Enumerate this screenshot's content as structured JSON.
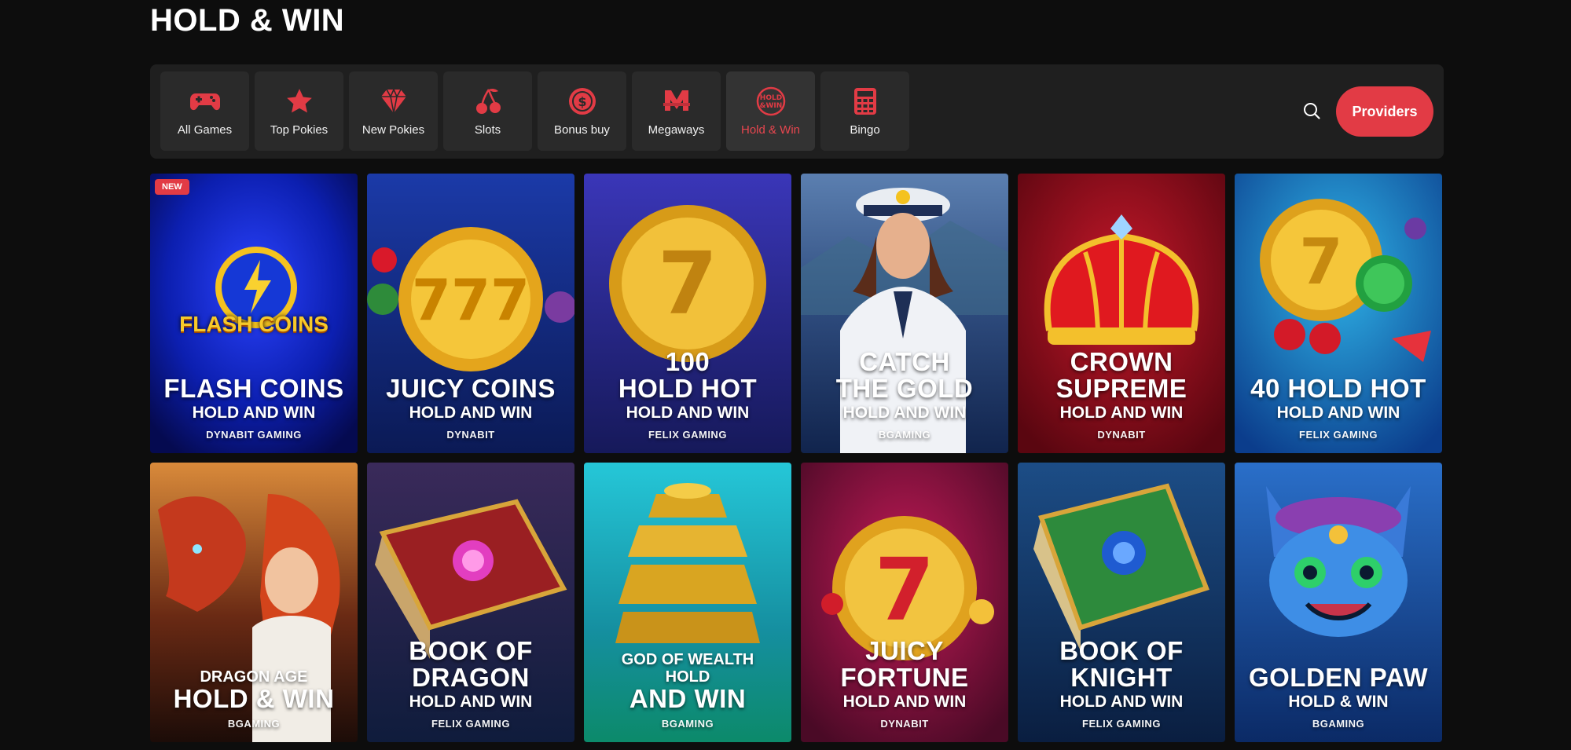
{
  "page": {
    "title": "HOLD & WIN"
  },
  "categories": [
    {
      "label": "All Games",
      "icon": "gamepad-icon",
      "active": false
    },
    {
      "label": "Top Pokies",
      "icon": "star-icon",
      "active": false
    },
    {
      "label": "New Pokies",
      "icon": "diamond-icon",
      "active": false
    },
    {
      "label": "Slots",
      "icon": "cherries-icon",
      "active": false
    },
    {
      "label": "Bonus buy",
      "icon": "coin-icon",
      "active": false
    },
    {
      "label": "Megaways",
      "icon": "megaways-icon",
      "active": false
    },
    {
      "label": "Hold & Win",
      "icon": "hold-win-icon",
      "active": true
    },
    {
      "label": "Bingo",
      "icon": "bingo-icon",
      "active": false
    }
  ],
  "toolbar": {
    "search_icon": "search-icon",
    "providers_label": "Providers"
  },
  "colors": {
    "accent": "#e23b45",
    "background": "#0d0d0d",
    "bar": "#1f1f1f"
  },
  "games": [
    {
      "badge": "NEW",
      "pre": "",
      "title": "FLASH COINS",
      "sub": "HOLD AND WIN",
      "provider": "DYNABIT GAMING",
      "logo": "FLASH COINS"
    },
    {
      "badge": "",
      "pre": "",
      "title": "JUICY COINS",
      "sub": "HOLD AND WIN",
      "provider": "DYNABIT",
      "logo": ""
    },
    {
      "badge": "",
      "pre": "",
      "title": "100\nHOLD HOT",
      "sub": "HOLD AND WIN",
      "provider": "FELIX GAMING",
      "logo": ""
    },
    {
      "badge": "",
      "pre": "",
      "title": "CATCH\nTHE GOLD",
      "sub": "HOLD AND WIN",
      "provider": "BGAMING",
      "logo": ""
    },
    {
      "badge": "",
      "pre": "",
      "title": "CROWN\nSUPREME",
      "sub": "HOLD AND WIN",
      "provider": "DYNABIT",
      "logo": ""
    },
    {
      "badge": "",
      "pre": "",
      "title": "40 HOLD HOT",
      "sub": "HOLD AND WIN",
      "provider": "FELIX GAMING",
      "logo": ""
    },
    {
      "badge": "",
      "pre": "DRAGON AGE",
      "title": "HOLD & WIN",
      "sub": "",
      "provider": "BGAMING",
      "logo": ""
    },
    {
      "badge": "",
      "pre": "",
      "title": "BOOK OF\nDRAGON",
      "sub": "HOLD AND WIN",
      "provider": "FELIX GAMING",
      "logo": ""
    },
    {
      "badge": "",
      "pre": "GOD OF WEALTH\nHOLD",
      "title": "AND WIN",
      "sub": "",
      "provider": "BGAMING",
      "logo": ""
    },
    {
      "badge": "",
      "pre": "",
      "title": "JUICY\nFORTUNE",
      "sub": "HOLD AND WIN",
      "provider": "DYNABIT",
      "logo": ""
    },
    {
      "badge": "",
      "pre": "",
      "title": "BOOK OF\nKNIGHT",
      "sub": "HOLD AND WIN",
      "provider": "FELIX GAMING",
      "logo": ""
    },
    {
      "badge": "",
      "pre": "",
      "title": "GOLDEN PAW",
      "sub": "HOLD & WIN",
      "provider": "BGAMING",
      "logo": ""
    }
  ]
}
